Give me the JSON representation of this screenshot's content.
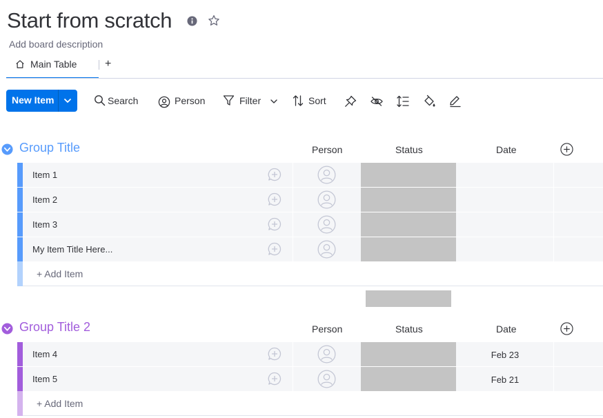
{
  "board": {
    "title": "Start from scratch",
    "description": "Add board description",
    "info_icon": "info-icon",
    "favorite_icon": "star-icon"
  },
  "tabs": {
    "main_label": "Main Table",
    "main_icon": "home-icon",
    "add_label": "+"
  },
  "toolbar": {
    "new_item_label": "New Item",
    "search_label": "Search",
    "person_label": "Person",
    "filter_label": "Filter",
    "sort_label": "Sort",
    "icons": [
      "pin-icon",
      "hide-icon",
      "row-height-icon",
      "paint-bucket-icon",
      "edit-icon"
    ]
  },
  "colors": {
    "accent": "#0073ea",
    "group1": "#579bfc",
    "group1_light": "#b2d2fd",
    "group2": "#a25ddc",
    "group2_light": "#d4b3ee",
    "status_empty": "#c4c4c4"
  },
  "columns": {
    "person": "Person",
    "status": "Status",
    "date": "Date"
  },
  "groups": [
    {
      "title": "Group Title",
      "items": [
        {
          "name": "Item 1",
          "date": ""
        },
        {
          "name": "Item 2",
          "date": ""
        },
        {
          "name": "Item 3",
          "date": ""
        },
        {
          "name": "My Item Title Here...",
          "date": ""
        }
      ],
      "add_item_label": "+ Add Item"
    },
    {
      "title": "Group Title 2",
      "items": [
        {
          "name": "Item 4",
          "date": "Feb 23"
        },
        {
          "name": "Item 5",
          "date": "Feb 21"
        }
      ],
      "add_item_label": "+ Add Item"
    }
  ]
}
